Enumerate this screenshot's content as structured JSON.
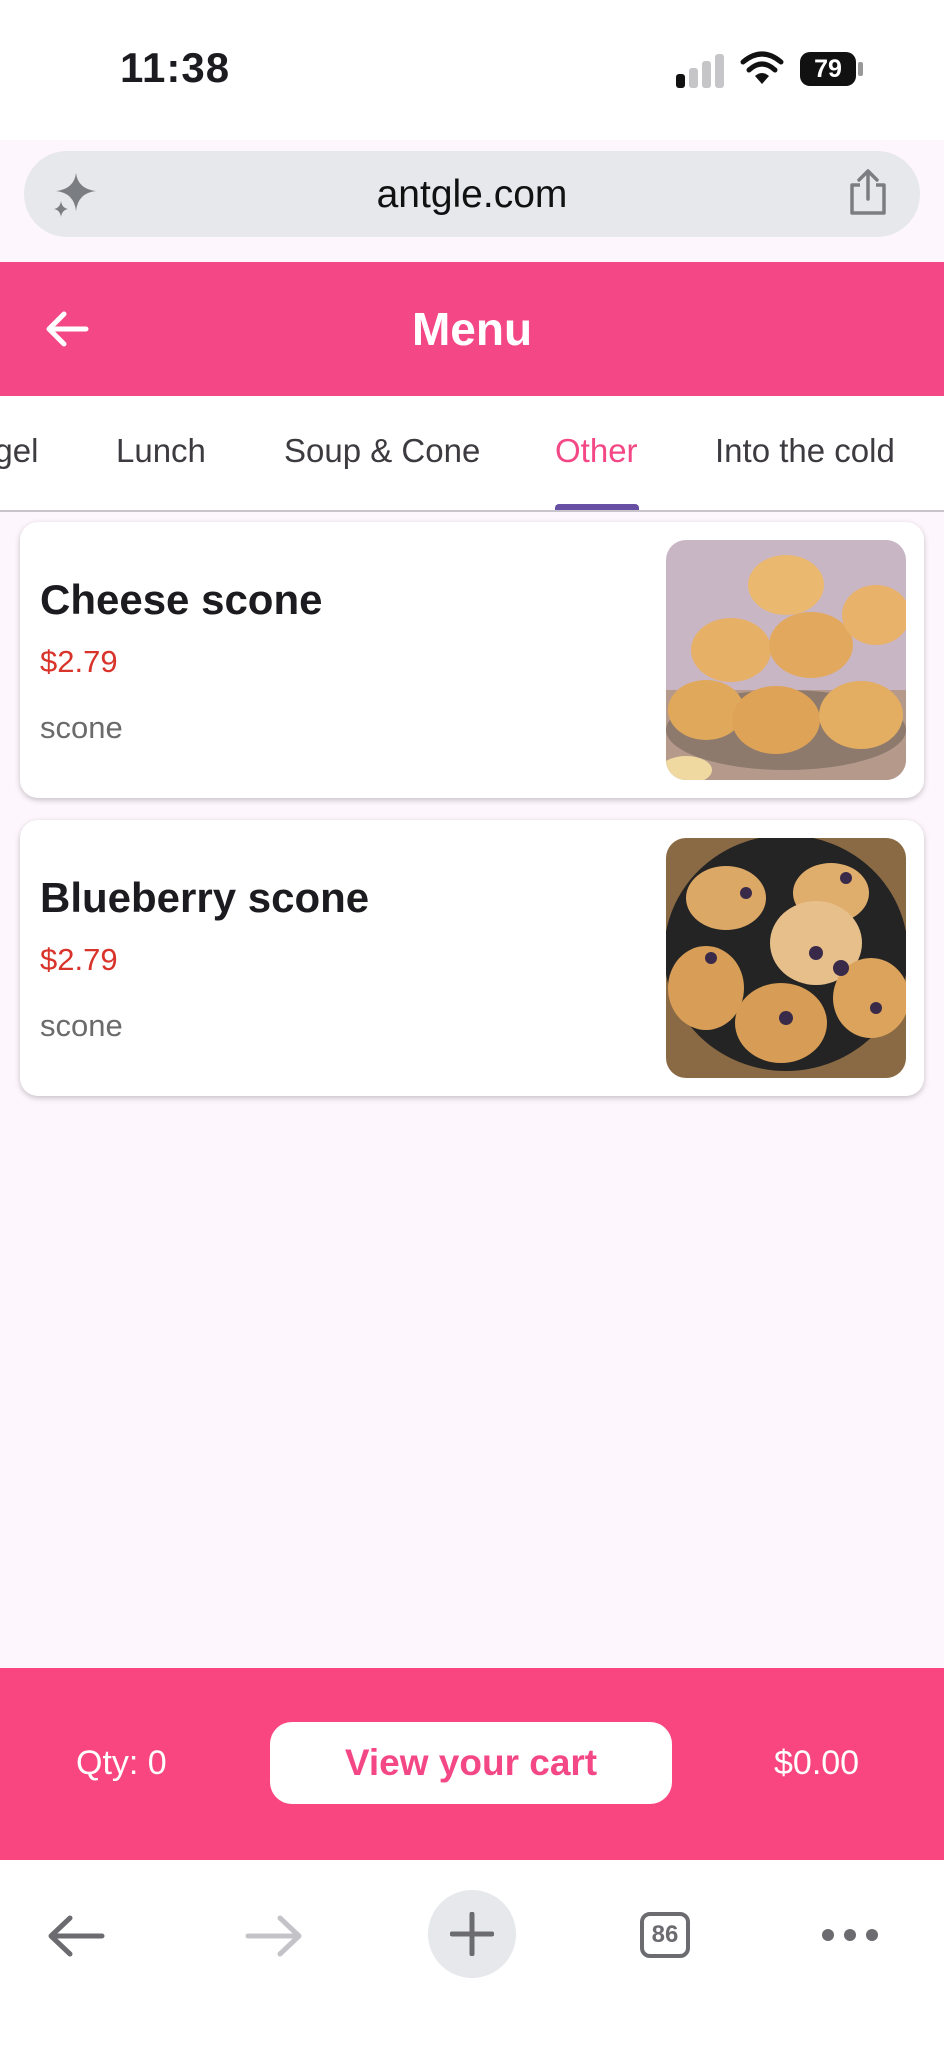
{
  "status_bar": {
    "time": "11:38",
    "battery": "79"
  },
  "browser": {
    "url": "antgle.com",
    "tab_count": "86"
  },
  "header": {
    "title": "Menu"
  },
  "tabs": [
    {
      "label": "Bagel"
    },
    {
      "label": "Lunch"
    },
    {
      "label": "Soup & Cone"
    },
    {
      "label": "Other",
      "active": true
    },
    {
      "label": "Into the cold"
    }
  ],
  "items": [
    {
      "name": "Cheese scone",
      "price": "$2.79",
      "description": "scone",
      "image": "cheese-scone-photo"
    },
    {
      "name": "Blueberry scone",
      "price": "$2.79",
      "description": "scone",
      "image": "blueberry-scone-photo"
    }
  ],
  "cart": {
    "qty_label": "Qty: 0",
    "button_label": "View your cart",
    "total": "$0.00"
  },
  "colors": {
    "brand": "#f44785",
    "price": "#d9342b",
    "tab_indicator": "#6750a4"
  }
}
